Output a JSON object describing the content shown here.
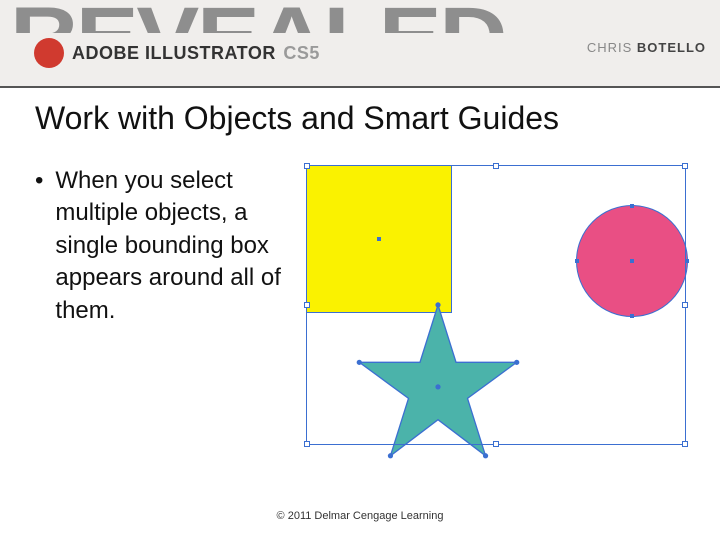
{
  "banner": {
    "revealed": "REVEALED",
    "brand_first": "ADOBE",
    "brand_product": "ILLUSTRATOR",
    "brand_version": "CS5",
    "author_first": "CHRIS",
    "author_last": "BOTELLO"
  },
  "slide": {
    "title": "Work with Objects and Smart Guides",
    "bullet_text": "When you select multiple objects, a single bounding box appears around all of them."
  },
  "shapes": {
    "square_fill": "#faf200",
    "circle_fill": "#e94f84",
    "star_fill": "#4bb3aa",
    "selection_stroke": "#3b6fd1"
  },
  "footer": {
    "copyright": "© 2011 Delmar Cengage Learning"
  }
}
